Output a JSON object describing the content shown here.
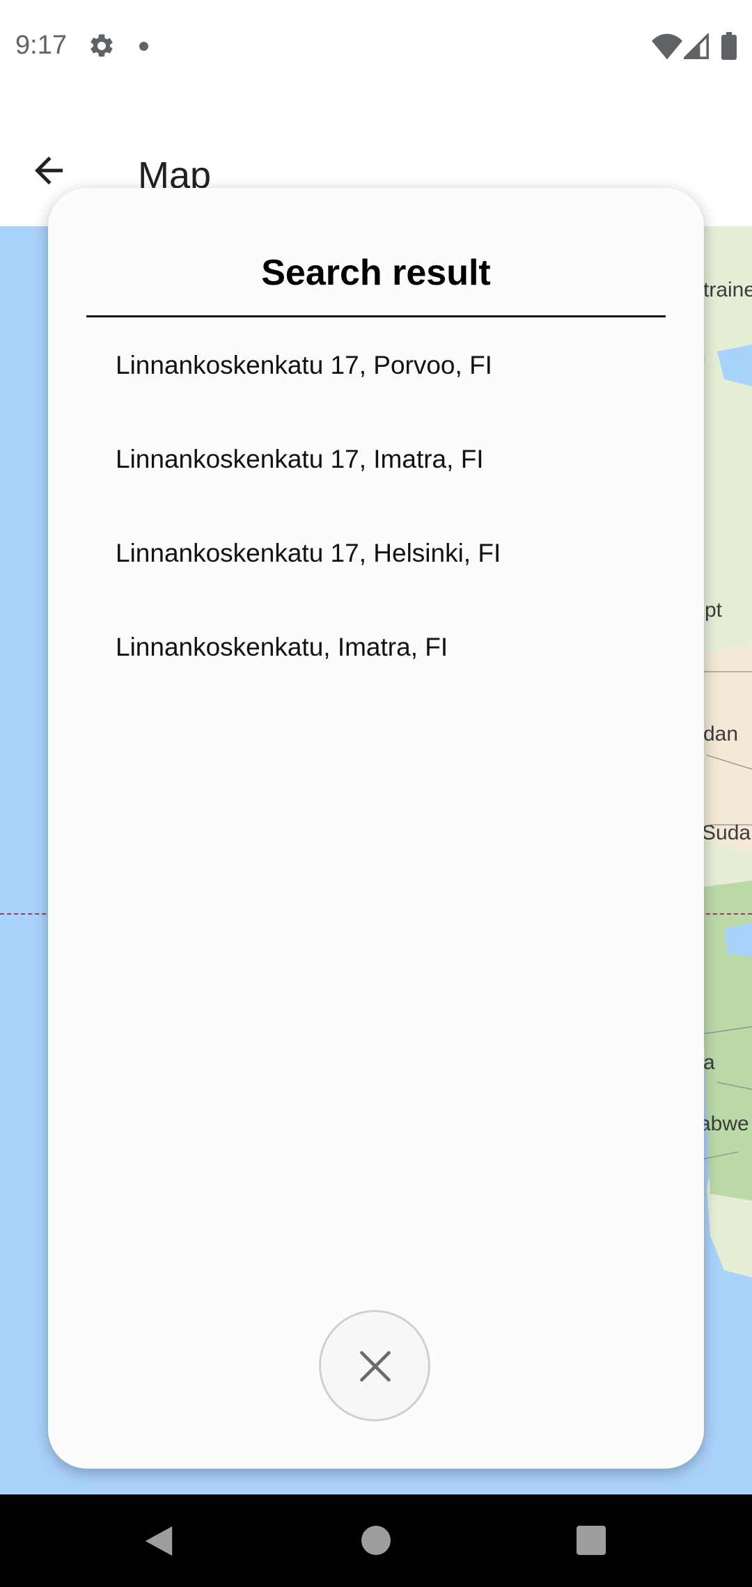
{
  "status_bar": {
    "time": "9:17",
    "icons": [
      "gear-icon",
      "notification-dot-icon",
      "wifi-icon",
      "signal-icon",
      "battery-icon"
    ]
  },
  "app_bar": {
    "title": "Map",
    "back_icon": "arrow-left-icon"
  },
  "map": {
    "labels": [
      "traine",
      "pt",
      "dan",
      "Sudan",
      "a",
      "abwe"
    ],
    "colors": {
      "water": "#aad3fb",
      "land": "#e6efd6",
      "equator": "#9b3b6b"
    }
  },
  "dialog": {
    "title": "Search result",
    "results": [
      {
        "label": "Linnankoskenkatu 17, Porvoo, FI"
      },
      {
        "label": "Linnankoskenkatu 17, Imatra, FI"
      },
      {
        "label": "Linnankoskenkatu 17, Helsinki, FI"
      },
      {
        "label": "Linnankoskenkatu, Imatra, FI"
      }
    ],
    "close_icon": "close-icon"
  },
  "nav_bar": {
    "icons": [
      "nav-back-icon",
      "nav-home-icon",
      "nav-recents-icon"
    ]
  }
}
